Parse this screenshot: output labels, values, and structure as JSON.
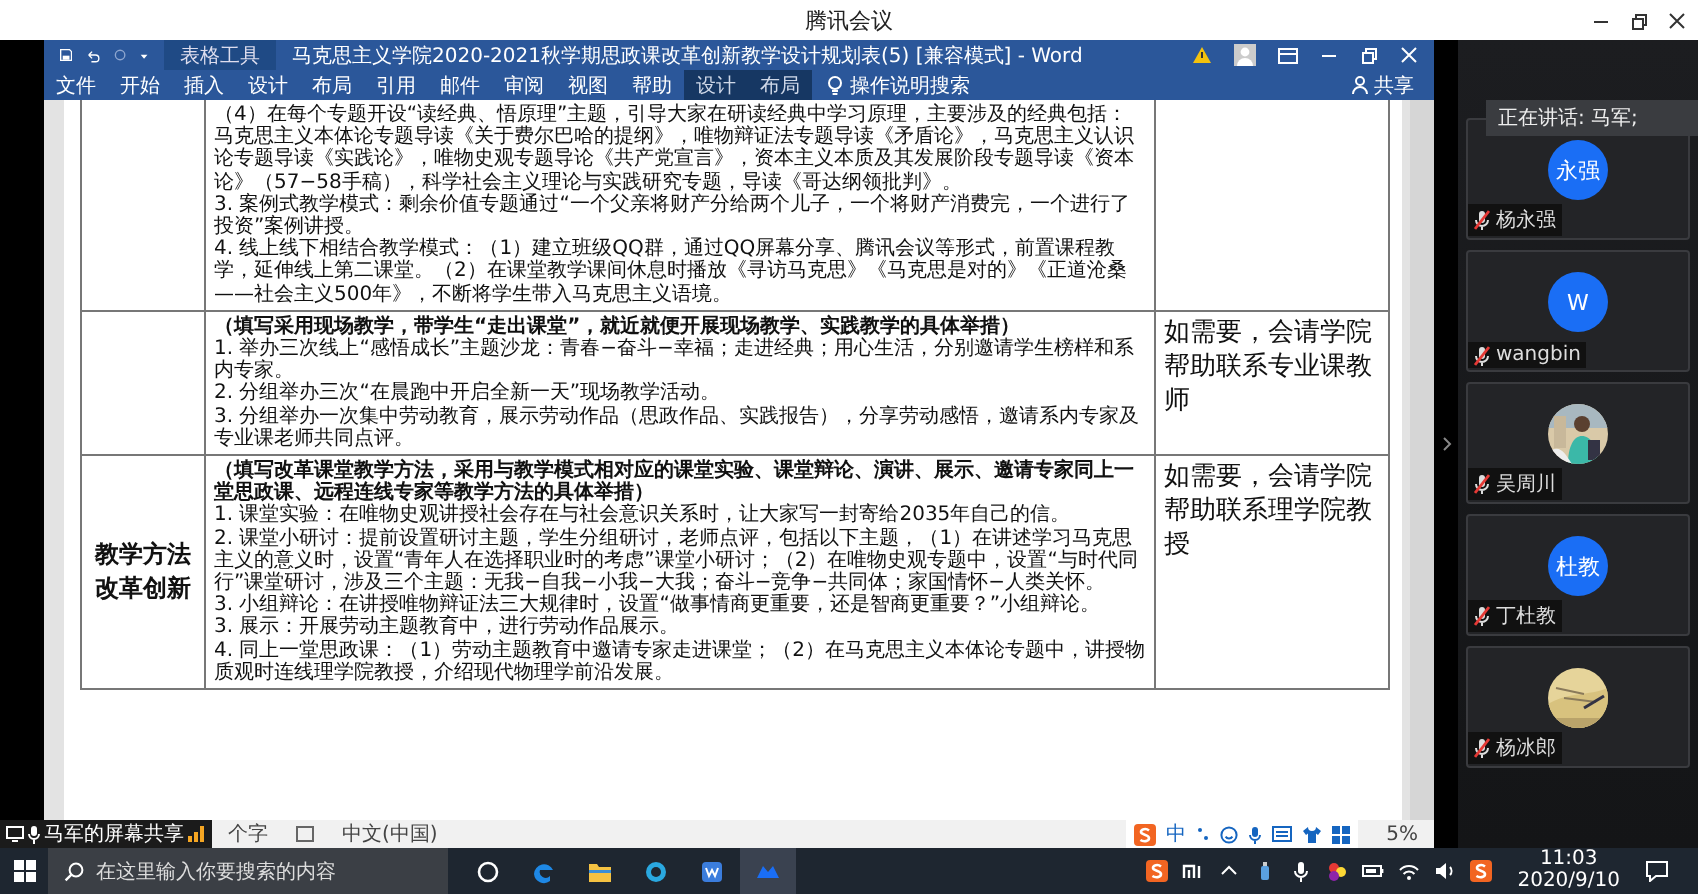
{
  "app": {
    "title": "腾讯会议"
  },
  "word": {
    "title": "马克思主义学院2020-2021秋学期思政课改革创新教学设计规划表(5) [兼容模式] - Word",
    "context_tab": "表格工具",
    "tabs": [
      {
        "label": "文件",
        "context": false
      },
      {
        "label": "开始",
        "context": false
      },
      {
        "label": "插入",
        "context": false
      },
      {
        "label": "设计",
        "context": false
      },
      {
        "label": "布局",
        "context": false
      },
      {
        "label": "引用",
        "context": false
      },
      {
        "label": "邮件",
        "context": false
      },
      {
        "label": "审阅",
        "context": false
      },
      {
        "label": "视图",
        "context": false
      },
      {
        "label": "帮助",
        "context": false
      },
      {
        "label": "设计",
        "context": true
      },
      {
        "label": "布局",
        "context": true
      }
    ],
    "search": "操作说明搜索",
    "share": "共享"
  },
  "document": {
    "rows": [
      {
        "label": "",
        "paragraphs": [
          {
            "kind": "item",
            "text": "（4）在每个专题开设“读经典、悟原理”主题，引导大家在研读经典中学习原理，主要涉及的经典包括：马克思主义本体论专题导读《关于费尔巴哈的提纲》，唯物辩证法专题导读《矛盾论》，马克思主义认识论专题导读《实践论》，唯物史观专题导论《共产党宣言》，资本主义本质及其发展阶段专题导读《资本论》（57−58手稿），科学社会主义理论与实践研究专题，导读《哥达纲领批判》。"
          },
          {
            "kind": "item",
            "text": "3. 案例式教学模式：剩余价值专题通过“一个父亲将财产分给两个儿子，一个将财产消费完，一个进行了投资”案例讲授。"
          },
          {
            "kind": "item",
            "text": "4. 线上线下相结合教学模式：（1）建立班级QQ群，通过QQ屏幕分享、腾讯会议等形式，前置课程教学，延伸线上第二课堂。（2）在课堂教学课间休息时播放《寻访马克思》《马克思是对的》《正道沧桑——社会主义500年》，不断将学生带入马克思主义语境。"
          }
        ],
        "note": ""
      },
      {
        "label": "",
        "paragraphs": [
          {
            "kind": "heading",
            "text": "（填写采用现场教学，带学生“走出课堂”，就近就便开展现场教学、实践教学的具体举措）"
          },
          {
            "kind": "item",
            "text": "1. 举办三次线上“感悟成长”主题沙龙：青春−奋斗−幸福；走进经典；用心生活，分别邀请学生榜样和系内专家。"
          },
          {
            "kind": "item",
            "text": "2. 分组举办三次“在晨跑中开启全新一天”现场教学活动。"
          },
          {
            "kind": "item",
            "text": "3. 分组举办一次集中劳动教育，展示劳动作品（思政作品、实践报告），分享劳动感悟，邀请系内专家及专业课老师共同点评。"
          }
        ],
        "note": "如需要，会请学院帮助联系专业课教师"
      },
      {
        "label": "教学方法改革创新",
        "paragraphs": [
          {
            "kind": "heading",
            "text": "（填写改革课堂教学方法，采用与教学模式相对应的课堂实验、课堂辩论、演讲、展示、邀请专家同上一堂思政课、远程连线专家等教学方法的具体举措）"
          },
          {
            "kind": "item",
            "text": "1. 课堂实验：在唯物史观讲授社会存在与社会意识关系时，让大家写一封寄给2035年自己的信。"
          },
          {
            "kind": "item",
            "text": "2. 课堂小研讨：提前设置研讨主题，学生分组研讨，老师点评，包括以下主题，（1）在讲述学习马克思主义的意义时，设置“青年人在选择职业时的考虑”课堂小研讨；（2）在唯物史观专题中，设置“与时代同行”课堂研讨，涉及三个主题：无我−自我−小我−大我；奋斗−竞争−共同体；家国情怀−人类关怀。"
          },
          {
            "kind": "item",
            "text": "3. 小组辩论：在讲授唯物辩证法三大规律时，设置“做事情商更重要，还是智商更重要？”小组辩论。"
          },
          {
            "kind": "item",
            "text": "3. 展示：开展劳动主题教育中，进行劳动作品展示。"
          },
          {
            "kind": "item",
            "text": "4. 同上一堂思政课：（1）劳动主题教育中邀请专家走进课堂；（2）在马克思主义本体论专题中，讲授物质观时连线理学院教授，介绍现代物理学前沿发展。"
          }
        ],
        "note": "如需要，会请学院帮助联系理学院教授"
      }
    ]
  },
  "status_bar": {
    "word_count": "个字",
    "language": "中文(中国)",
    "ime_mode": "中",
    "zoom": "5%"
  },
  "screen_share": {
    "label": "马军的屏幕共享"
  },
  "meeting": {
    "speaking": "正在讲话: 马军;",
    "participants": [
      {
        "name": "杨永强",
        "avatar": {
          "kind": "initials",
          "text": "永强"
        },
        "muted": true
      },
      {
        "name": "wangbin",
        "avatar": {
          "kind": "initials",
          "text": "W"
        },
        "muted": true
      },
      {
        "name": "吴周川",
        "muted": true
      },
      {
        "name": "丁杜教",
        "avatar": {
          "kind": "initials",
          "text": "杜教"
        },
        "muted": true
      },
      {
        "name": "杨冰郎",
        "muted": true
      }
    ]
  },
  "taskbar": {
    "search": {
      "placeholder": "在这里输入你要搜索的内容"
    },
    "time": "11:03",
    "date": "2020/9/10"
  }
}
